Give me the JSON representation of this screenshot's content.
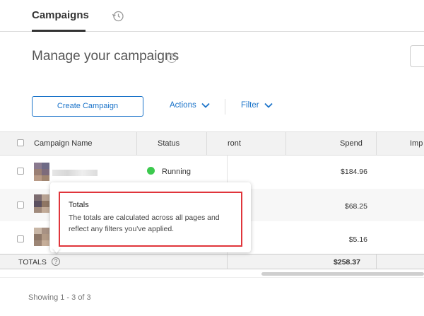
{
  "tabs": {
    "campaigns_label": "Campaigns",
    "history_icon": "history-icon"
  },
  "header": {
    "title": "Manage your campaigns",
    "help_icon": "help-circle-icon"
  },
  "toolbar": {
    "create_label": "Create Campaign",
    "actions_label": "Actions",
    "filter_label": "Filter"
  },
  "table": {
    "columns": [
      "Campaign Name",
      "Status",
      "ront",
      "Spend",
      "Imp"
    ],
    "rows": [
      {
        "status": "Running",
        "spend": "$184.96"
      },
      {
        "status": "",
        "spend": "$68.25"
      },
      {
        "status": "",
        "spend": "$5.16"
      }
    ],
    "totals_label": "TOTALS",
    "totals_spend": "$258.37"
  },
  "tooltip": {
    "title": "Totals",
    "body": "The totals are calculated across all pages and reflect any filters you've applied."
  },
  "footer": {
    "showing": "Showing 1 - 3 of 3"
  },
  "colors": {
    "accent": "#1a73c9",
    "running": "#3cc94e",
    "highlight": "#e0353b"
  }
}
